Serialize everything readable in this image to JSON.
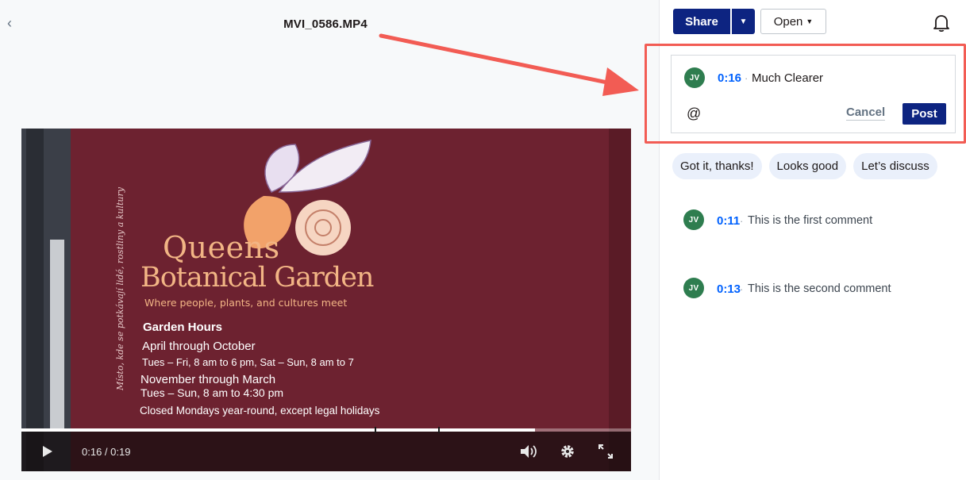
{
  "header": {
    "back_icon": "chevron-left-icon",
    "file_name": "MVI_0586.MP4"
  },
  "video": {
    "sign": {
      "title_line1": "Queens",
      "title_line2": "Botanical Garden",
      "tagline": "Where people, plants, and cultures meet",
      "hours_heading": "Garden Hours",
      "season1": "April through October",
      "season1_hours": "Tues – Fri, 8 am to 6 pm, Sat – Sun, 8 am to 7",
      "season2": "November through March",
      "season2_hours": "Tues – Sun, 8 am to 4:30 pm",
      "closed": "Closed Mondays year-round, except legal holidays"
    },
    "current_time": "0:16",
    "duration": "0:19",
    "time_display": "0:16 / 0:19",
    "progress_fraction": 0.8421,
    "marker_fractions": [
      0.5789,
      0.6842
    ]
  },
  "toolbar": {
    "share_label": "Share",
    "open_label": "Open",
    "bell_icon": "bell-icon"
  },
  "editor": {
    "avatar_initials": "JV",
    "timestamp": "0:16",
    "separator": "·",
    "text": "Much Clearer",
    "mention_label": "@",
    "cancel_label": "Cancel",
    "post_label": "Post"
  },
  "quick_replies": [
    "Got it, thanks!",
    "Looks good",
    "Let’s discuss"
  ],
  "comments": [
    {
      "initials": "JV",
      "timestamp": "0:11",
      "text": "This is the first comment"
    },
    {
      "initials": "JV",
      "timestamp": "0:13",
      "text": "This is the second comment"
    }
  ],
  "colors": {
    "brand_navy": "#0d2481",
    "timestamp_blue": "#0061fe",
    "avatar_green": "#2e7d4f",
    "annotation_red": "#f25c54",
    "sign_maroon": "#6a1f2c"
  }
}
